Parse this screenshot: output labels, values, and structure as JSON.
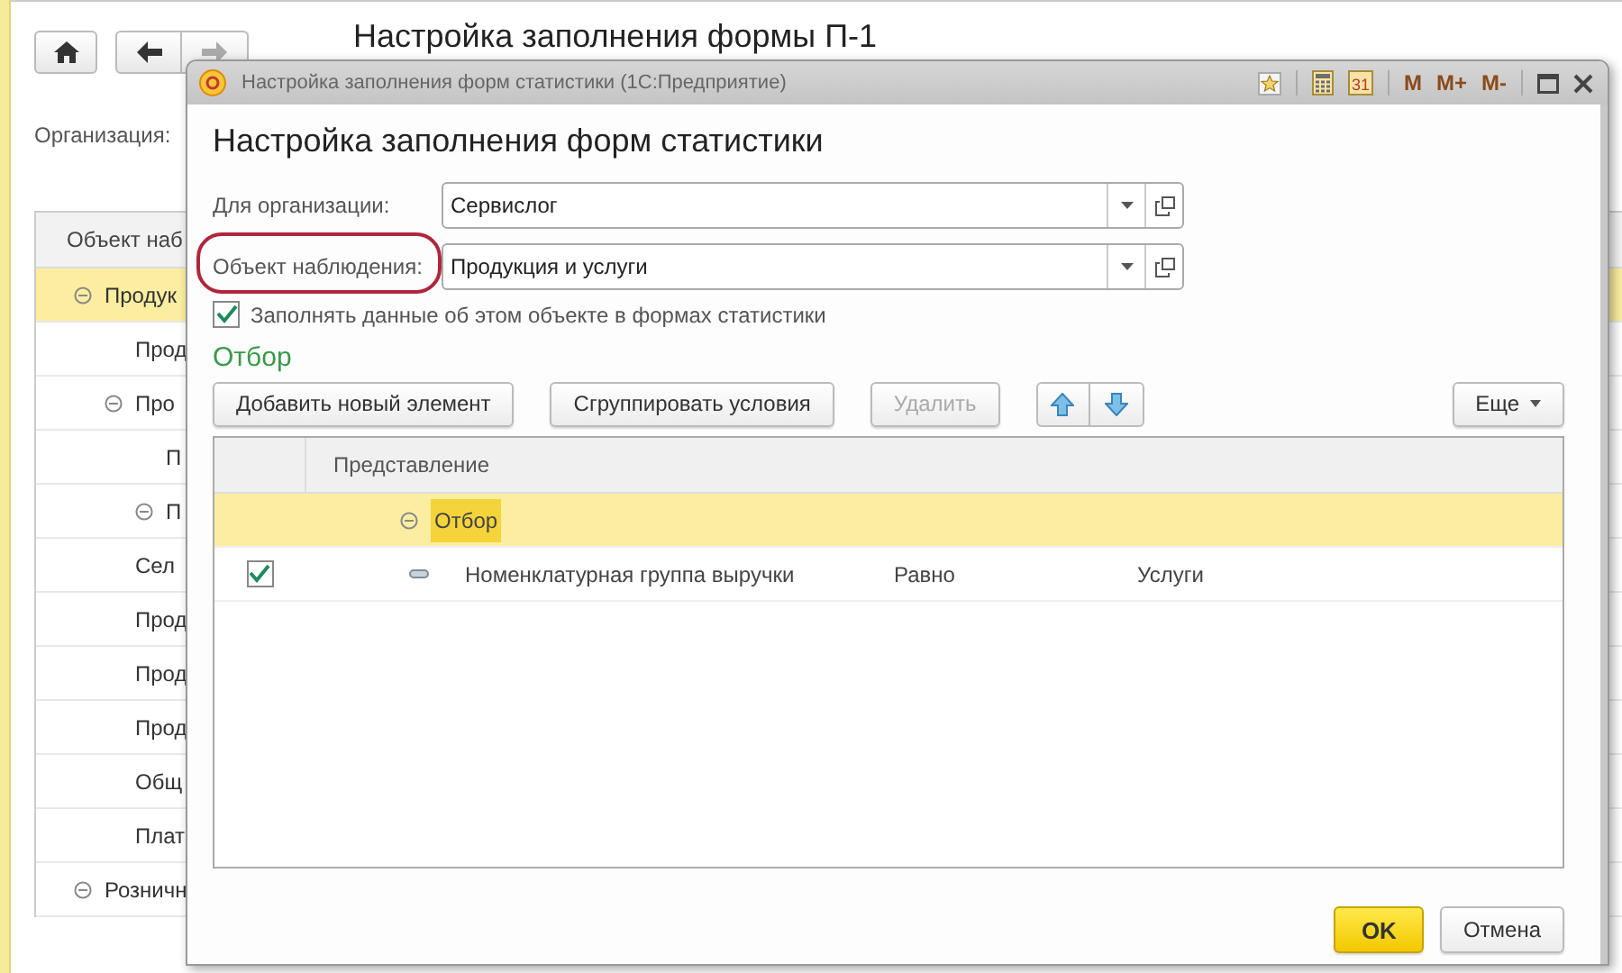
{
  "background": {
    "title": "Настройка заполнения формы П-1",
    "organization_label": "Организация:",
    "tree": {
      "column": "Объект наб",
      "rows": [
        {
          "label": "Продук",
          "selected": true,
          "expanded": true,
          "children": [
            {
              "label": "Прод",
              "selected": false
            },
            {
              "label": "Про",
              "selected": false,
              "expanded": true,
              "children": [
                {
                  "label": "П",
                  "selected": false
                },
                {
                  "label": "П",
                  "selected": false,
                  "expanded": true
                }
              ]
            },
            {
              "label": "Сел",
              "selected": false
            },
            {
              "label": "Прод",
              "selected": false
            },
            {
              "label": "Прод",
              "selected": false
            },
            {
              "label": "Прод",
              "selected": false
            },
            {
              "label": "Общ",
              "selected": false
            },
            {
              "label": "Плат",
              "selected": false
            }
          ]
        },
        {
          "label": "Розничн",
          "selected": false,
          "expanded": true
        }
      ]
    }
  },
  "dialog": {
    "window_title": "Настройка заполнения форм статистики  (1С:Предприятие)",
    "title_tools": [
      {
        "kind": "favorite"
      },
      {
        "kind": "calculator"
      },
      {
        "kind": "calendar",
        "label": "31"
      },
      {
        "kind": "memory",
        "label": "M"
      },
      {
        "kind": "memory",
        "label": "M+"
      },
      {
        "kind": "memory",
        "label": "M-"
      },
      {
        "kind": "maximize"
      },
      {
        "kind": "close"
      }
    ],
    "heading": "Настройка заполнения форм статистики",
    "fields": [
      {
        "label": "Для организации:",
        "value": "Сервислог",
        "highlighted": false
      },
      {
        "label": "Объект наблюдения:",
        "value": "Продукция и услуги",
        "highlighted": true
      }
    ],
    "fill_checkbox": {
      "label": "Заполнять данные об этом объекте в формах статистики",
      "checked": true
    },
    "section": "Отбор",
    "toolbar": [
      {
        "label": "Добавить новый элемент",
        "disabled": false
      },
      {
        "label": "Сгруппировать условия",
        "disabled": false
      },
      {
        "label": "Удалить",
        "disabled": true
      }
    ],
    "more": "Еще",
    "table": {
      "columns": [
        "Представление"
      ],
      "rows": [
        {
          "kind": "group",
          "label": "Отбор",
          "selected": true,
          "expanded": true,
          "children": [
            {
              "kind": "condition",
              "checked": true,
              "selected": false,
              "field": "Номенклатурная группа выручки",
              "comparison": "Равно",
              "value": "Услуги"
            }
          ]
        }
      ]
    },
    "buttons": [
      {
        "label": "OK",
        "default": true
      },
      {
        "label": "Отмена",
        "default": false
      }
    ]
  }
}
